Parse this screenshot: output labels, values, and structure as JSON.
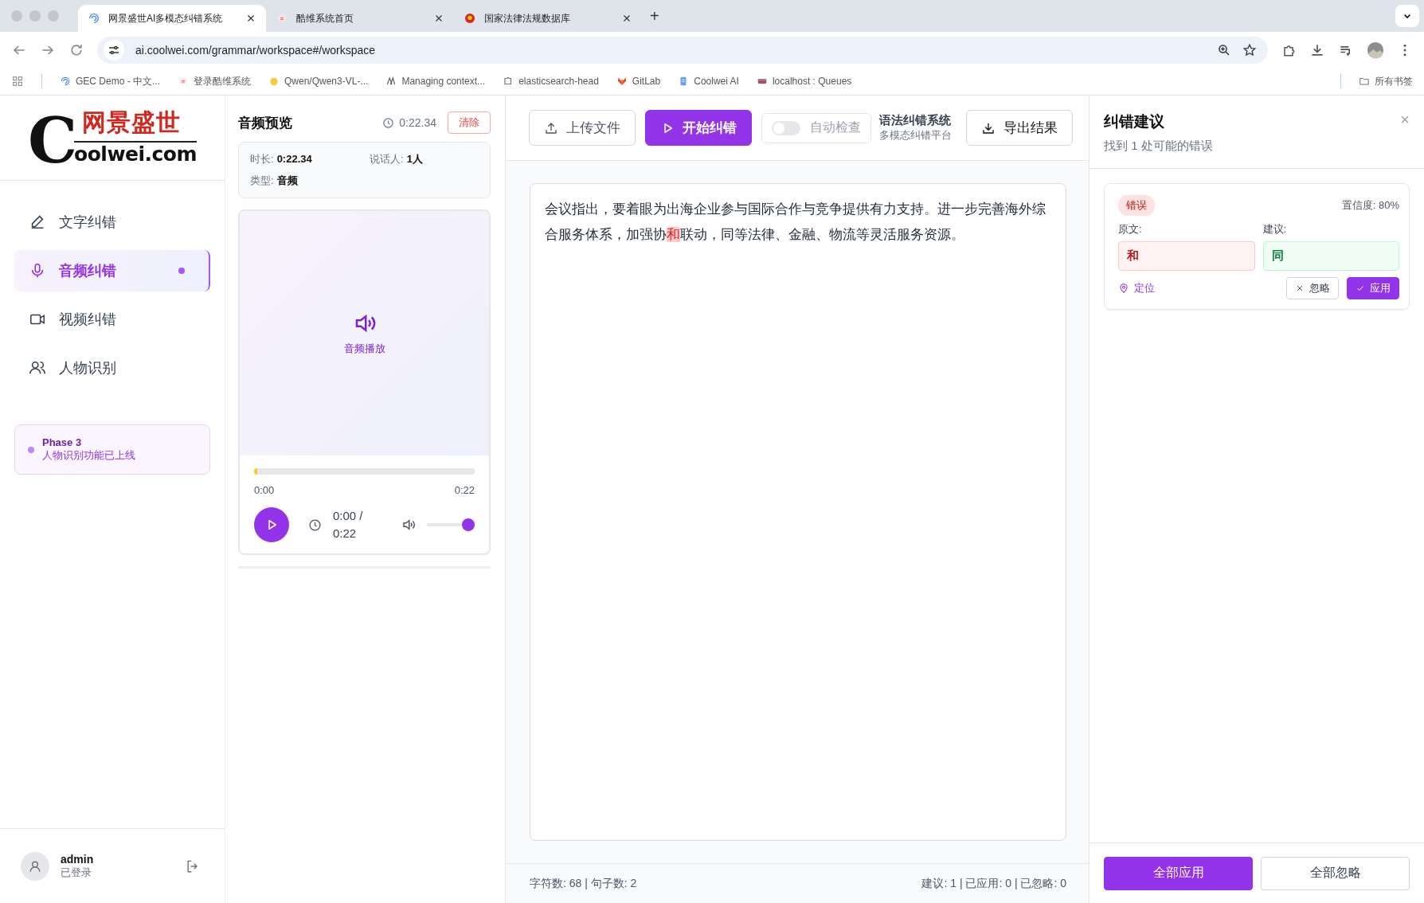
{
  "browser": {
    "tabs": [
      {
        "title": "网景盛世AI多模态纠错系统",
        "selected": true
      },
      {
        "title": "酷维系统首页",
        "selected": false
      },
      {
        "title": "国家法律法规数据库",
        "selected": false
      }
    ],
    "new_tab": "+",
    "url": "ai.coolwei.com/grammar/workspace#/workspace",
    "bookmarks": [
      "GEC Demo - 中文...",
      "登录酷维系统",
      "Qwen/Qwen3-VL-...",
      "Managing context...",
      "elasticsearch-head",
      "GitLab",
      "Coolwei AI",
      "localhost : Queues"
    ],
    "all_bookmarks": "所有书签"
  },
  "sidebar": {
    "logo": {
      "mark": "C",
      "title": "网景盛世",
      "domain": "oolwei.com"
    },
    "items": [
      {
        "label": "文字纠错",
        "selected": false
      },
      {
        "label": "音频纠错",
        "selected": true
      },
      {
        "label": "视频纠错",
        "selected": false
      },
      {
        "label": "人物识别",
        "selected": false
      }
    ],
    "notice": {
      "title": "Phase 3",
      "text": "人物识别功能已上线"
    },
    "user": {
      "name": "admin",
      "status": "已登录"
    }
  },
  "audio": {
    "title": "音频预览",
    "duration": "0:22.34",
    "clear": "清除",
    "info": [
      {
        "label": "时长:",
        "value": "0:22.34"
      },
      {
        "label": "说话人:",
        "value": "1人"
      },
      {
        "label": "类型:",
        "value": "音频"
      }
    ],
    "player": {
      "caption": "音频播放",
      "progress": {
        "level": 0.015
      },
      "start": "0:00",
      "end": "0:22",
      "time": "0:00 / 0:22",
      "volume": {
        "level": 1
      }
    }
  },
  "toolbar": {
    "upload": "上传文件",
    "start": "开始纠错",
    "auto_check": {
      "label": "自动检查",
      "on": false
    },
    "system_title": "语法纠错系统",
    "system_subtitle": "多模态纠错平台",
    "export": "导出结果"
  },
  "editor": {
    "segments": [
      {
        "text": "会议指出，要着眼为出海企业参与国际合作与竞争提供有力支持。进一步完善海外综合服务体系，加强协",
        "error": false
      },
      {
        "text": "和",
        "error": true
      },
      {
        "text": "联动，同等法律、金融、物流等灵活服务资源。",
        "error": false
      }
    ]
  },
  "status_bar": {
    "left": "字符数: 68 | 句子数: 2",
    "right": "建议: 1 | 已应用: 0 | 已忽略: 0"
  },
  "suggestions": {
    "title": "纠错建议",
    "subtitle": "找到 1 处可能的错误",
    "close": "×",
    "items": [
      {
        "badge": "错误",
        "confidence": "置信度: 80%",
        "original_label": "原文:",
        "original": "和",
        "suggestion_label": "建议:",
        "suggestion": "同",
        "locate": "定位",
        "ignore": "忽略",
        "apply": "应用"
      }
    ],
    "apply_all": "全部应用",
    "ignore_all": "全部忽略"
  }
}
